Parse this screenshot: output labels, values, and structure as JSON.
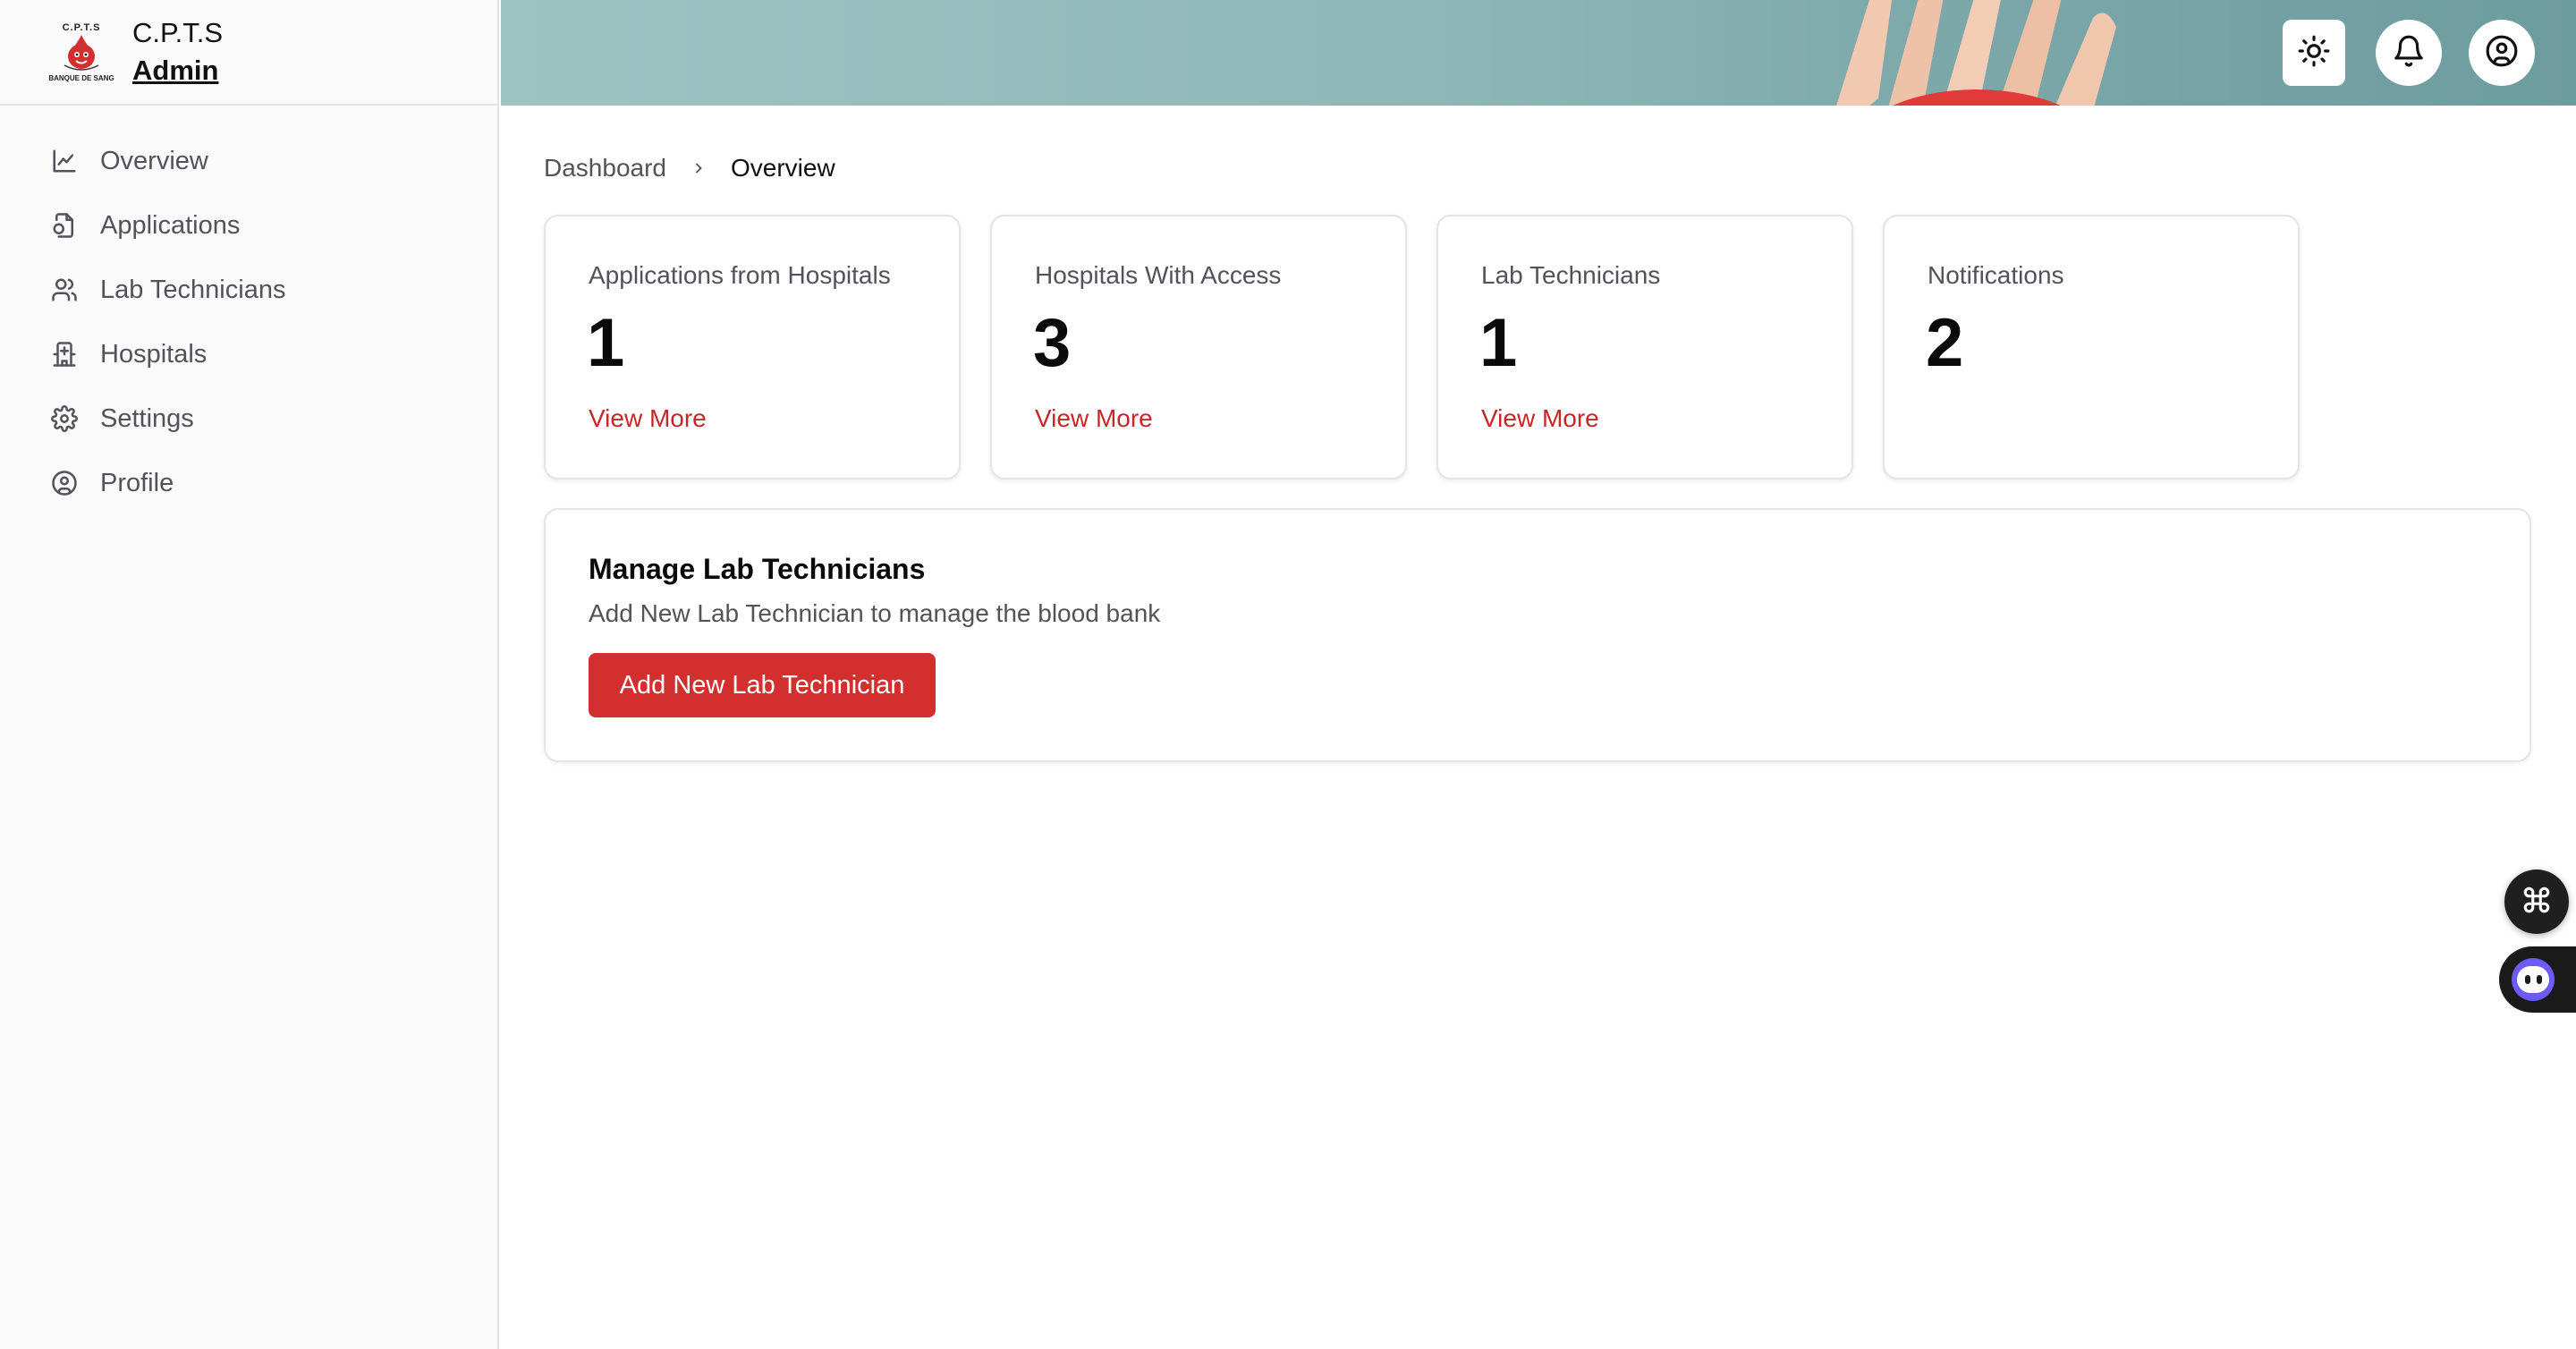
{
  "brand": {
    "logo_top": "C.P.T.S",
    "logo_bottom": "BANQUE DE SANG",
    "name": "C.P.T.S",
    "role": "Admin"
  },
  "sidebar": {
    "items": [
      {
        "label": "Overview",
        "icon": "line-chart-icon"
      },
      {
        "label": "Applications",
        "icon": "file-icon"
      },
      {
        "label": "Lab Technicians",
        "icon": "users-icon"
      },
      {
        "label": "Hospitals",
        "icon": "hospital-icon"
      },
      {
        "label": "Settings",
        "icon": "gear-icon"
      },
      {
        "label": "Profile",
        "icon": "user-circle-icon"
      }
    ]
  },
  "header": {
    "buttons": [
      {
        "icon": "sun-icon"
      },
      {
        "icon": "bell-icon"
      },
      {
        "icon": "user-circle-icon"
      }
    ]
  },
  "breadcrumb": {
    "parent": "Dashboard",
    "current": "Overview"
  },
  "stats": [
    {
      "title": "Applications from Hospitals",
      "value": "1",
      "link": "View More"
    },
    {
      "title": "Hospitals With Access",
      "value": "3",
      "link": "View More"
    },
    {
      "title": "Lab Technicians",
      "value": "1",
      "link": "View More"
    },
    {
      "title": "Notifications",
      "value": "2",
      "link": ""
    }
  ],
  "manage": {
    "title": "Manage Lab Technicians",
    "description": "Add New Lab Technician to manage the blood bank",
    "button": "Add New Lab Technician"
  },
  "colors": {
    "accent": "#d32f2f",
    "link": "#c62828",
    "header_bg": "#8fb7b8"
  }
}
